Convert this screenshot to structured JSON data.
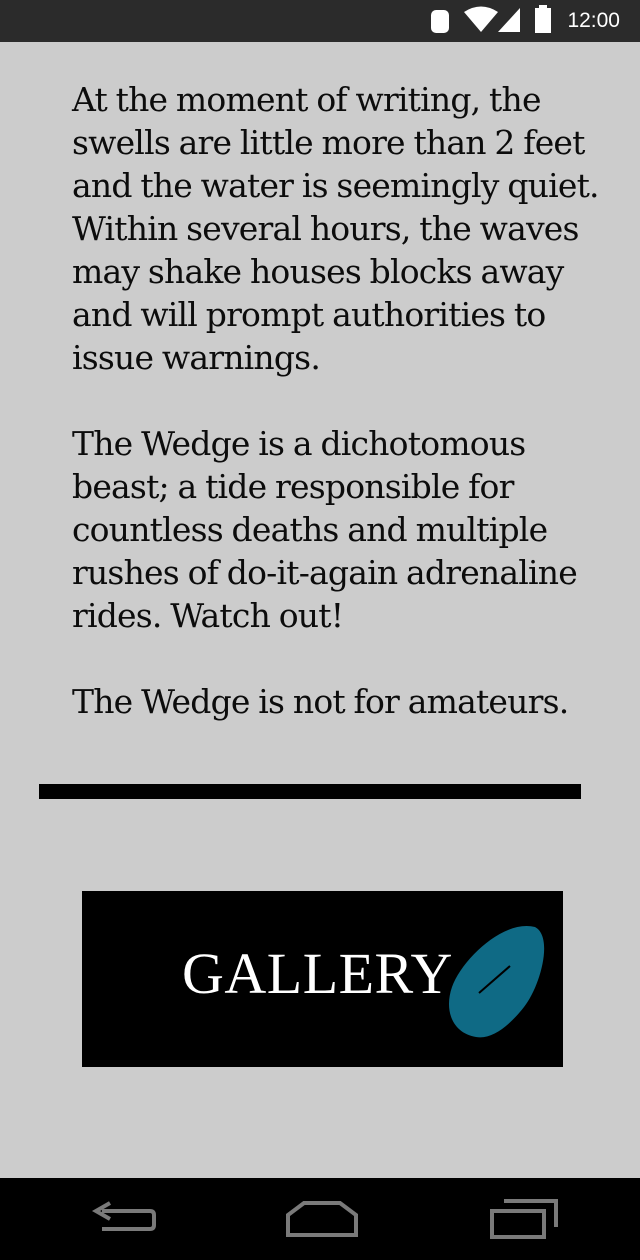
{
  "status_bar": {
    "time": "12:00",
    "icons": [
      "phone-icon",
      "wifi-icon",
      "cell-signal-icon",
      "battery-icon"
    ]
  },
  "article": {
    "paragraphs": [
      "At the moment of writing, the swells are little more than 2 feet and the water is seemingly quiet. Within several hours, the waves may shake houses blocks away and will prompt authorities to issue warnings.",
      "The Wedge is a dichotomous beast; a tide responsible for countless deaths and multiple rushes of do-it-again adrenaline rides. Watch out!",
      "The Wedge is not for amateurs."
    ]
  },
  "gallery_button": {
    "label": "GALLERY",
    "icon": "leaf-icon",
    "icon_color": "#0f6a85"
  },
  "nav_bar": {
    "buttons": [
      "back-icon",
      "home-icon",
      "recent-apps-icon"
    ]
  },
  "colors": {
    "background": "#cccccc",
    "text": "#0c0c0c",
    "button_bg": "#000000",
    "accent": "#0f6a85"
  }
}
